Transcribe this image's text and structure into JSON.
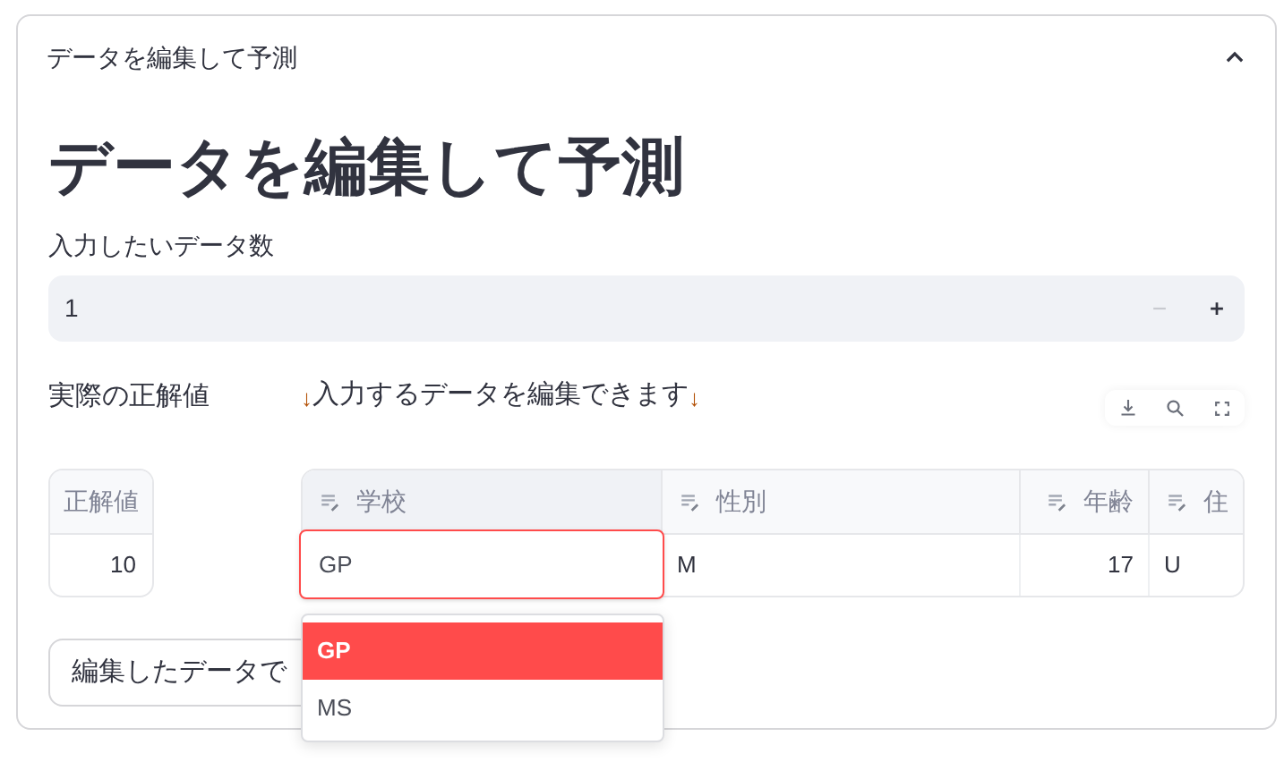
{
  "expander": {
    "title": "データを編集して予測",
    "expanded": true
  },
  "heading": "データを編集して予測",
  "count_input": {
    "label": "入力したいデータ数",
    "value": "1",
    "minus_disabled": true
  },
  "truth": {
    "label": "実際の正解値",
    "columns": [
      "正解値"
    ],
    "rows": [
      [
        "10"
      ]
    ]
  },
  "editor": {
    "note": {
      "prefix": "↓",
      "text": "入力するデータを編集できます",
      "suffix": "↓"
    },
    "columns": [
      {
        "label": "学校"
      },
      {
        "label": "性別"
      },
      {
        "label": "年齢"
      },
      {
        "label": "住"
      }
    ],
    "rows": [
      [
        {
          "kind": "editing",
          "value": "GP"
        },
        {
          "kind": "text",
          "value": "M"
        },
        {
          "kind": "number",
          "value": "17"
        },
        {
          "kind": "text",
          "value": "U"
        }
      ]
    ],
    "options": [
      {
        "label": "GP",
        "selected": true
      },
      {
        "label": "MS",
        "selected": false
      }
    ]
  },
  "button": {
    "label": "編集したデータで"
  }
}
